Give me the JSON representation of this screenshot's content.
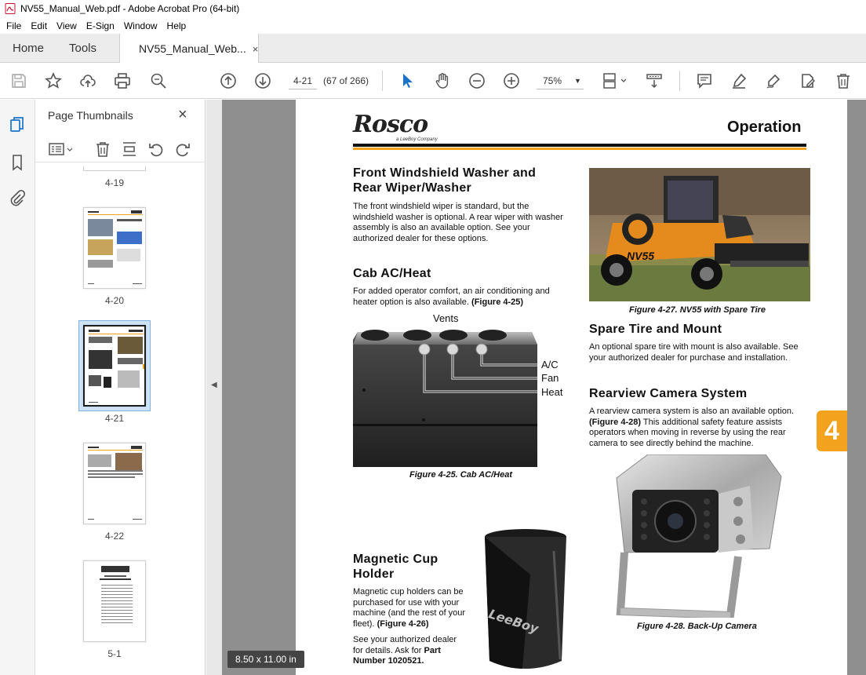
{
  "window": {
    "title": "NV55_Manual_Web.pdf - Adobe Acrobat Pro (64-bit)"
  },
  "menu": [
    "File",
    "Edit",
    "View",
    "E-Sign",
    "Window",
    "Help"
  ],
  "tabs": {
    "home": "Home",
    "tools": "Tools",
    "doc": "NV55_Manual_Web...",
    "close": "×"
  },
  "toolbar": {
    "page_value": "4-21",
    "page_count": "(67 of 266)",
    "zoom": "75%"
  },
  "thumbnails": {
    "title": "Page Thumbnails",
    "close": "×",
    "labels": [
      "4-19",
      "4-20",
      "4-21",
      "4-22",
      "5-1"
    ]
  },
  "status": {
    "page_size": "8.50 x 11.00 in"
  },
  "page": {
    "header_right": "Operation",
    "logo_text": "Rosco",
    "logo_sub": "a LeeBoy Company",
    "chapter_tab": "4",
    "s1": {
      "title": "Front Windshield Washer and Rear Wiper/Washer",
      "body": "The front windshield wiper is standard, but the windshield washer is optional.  A rear wiper with washer assembly is also an available option.  See your authorized dealer for these options."
    },
    "s2": {
      "title": "Cab AC/Heat",
      "body": "For added operator comfort, an air conditioning and heater option is also available.",
      "ref": "(Figure 4-25)"
    },
    "fig25": {
      "vents": "Vents",
      "ac": "A/C",
      "fan": "Fan",
      "heat": "Heat",
      "caption": "Figure 4-25.  Cab AC/Heat"
    },
    "s3": {
      "title": "Magnetic Cup Holder",
      "body1": "Magnetic cup holders can be purchased for use with your machine (and the rest of your fleet).",
      "ref": "(Figure 4-26)",
      "body2": "See your authorized dealer for details.  Ask for",
      "part": "Part Number 1020521."
    },
    "fig27": {
      "caption": "Figure 4-27.  NV55 with Spare Tire",
      "decal": "NV55"
    },
    "s4": {
      "title": "Spare Tire and Mount",
      "body": "An optional spare tire with mount is also available.  See your authorized dealer for purchase and installation."
    },
    "s5": {
      "title": "Rearview Camera System",
      "body1": "A rearview camera system is also an available option.",
      "ref": "(Figure 4-28)",
      "body2": "This additional safety feature assists operators when moving in reverse by using the rear camera to see directly behind the machine."
    },
    "fig28": {
      "caption": "Figure 4-28.  Back-Up Camera"
    },
    "cup_brand": "LeeBoy"
  },
  "colors": {
    "accent_orange": "#f3a21d",
    "selection_blue": "#3b82d6",
    "icon_blue": "#1a73c9"
  }
}
